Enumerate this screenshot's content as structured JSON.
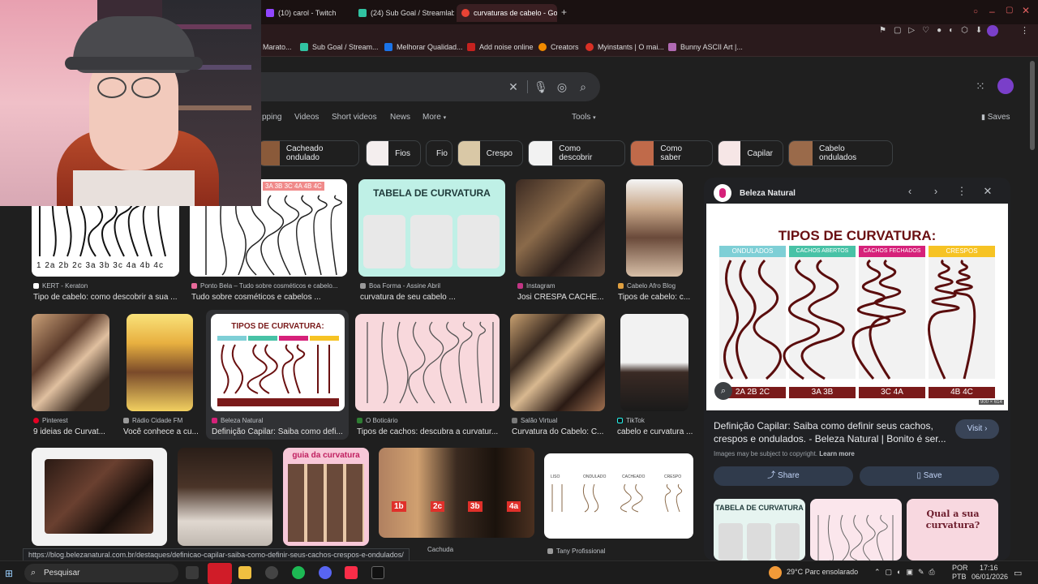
{
  "browser": {
    "tabs": [
      {
        "label": "(10) carol - Twitch",
        "color": "#9146ff"
      },
      {
        "label": "(24) Sub Goal / Streamlab",
        "color": "#31c3a2"
      },
      {
        "label": "curvaturas de cabelo - Go",
        "color": "#ea4335"
      }
    ],
    "bookmarks": [
      {
        "label": "Marato...",
        "color": "#d93025"
      },
      {
        "label": "Sub Goal / Stream...",
        "color": "#31c3a2"
      },
      {
        "label": "Melhorar Qualidad...",
        "color": "#1a73e8"
      },
      {
        "label": "Add noise online",
        "color": "#c5221f"
      },
      {
        "label": "Creators",
        "color": "#f28b00"
      },
      {
        "label": "Myinstants | O mai...",
        "color": "#d93025"
      },
      {
        "label": "Bunny ASCII Art |...",
        "color": "#b06ab3"
      }
    ]
  },
  "search": {
    "tabs": [
      "pping",
      "Videos",
      "Short videos",
      "News",
      "More",
      "Tools"
    ],
    "saves_label": "Saves"
  },
  "chips": [
    {
      "label": "Cacheado ondulado"
    },
    {
      "label": "Fios"
    },
    {
      "label": "Fio"
    },
    {
      "label": "Crespo"
    },
    {
      "label": "Como descobrir"
    },
    {
      "label": "Como saber"
    },
    {
      "label": "Capilar"
    },
    {
      "label": "Cabelo ondulados"
    }
  ],
  "results": [
    {
      "source": "KERT - Keraton",
      "title": "Tipo de cabelo: como descobrir a sua ...",
      "img_text": "1 2a 2b 2c 3a 3b 3c 4a 4b 4c"
    },
    {
      "source": "Ponto Bela – Tudo sobre cosméticos e cabelo...",
      "title": "Tudo sobre cosméticos e cabelos ...",
      "img_text": "3A 3B 3C 4A 4B 4C"
    },
    {
      "source": "Boa Forma - Assine Abril",
      "title": "curvatura de seu cabelo ...",
      "img_text": "TABELA DE CURVATURA"
    },
    {
      "source": "Instagram",
      "title": "Josi CRESPA CACHE...",
      "img_text": ""
    },
    {
      "source": "Cabelo Afro Blog",
      "title": "Tipos de cabelo: c...",
      "img_text": ""
    },
    {
      "source": "Pinterest",
      "title": "9 ideias de Curvat...",
      "img_text": ""
    },
    {
      "source": "Rádio Cidade FM",
      "title": "Você conhece a cu...",
      "img_text": ""
    },
    {
      "source": "Beleza Natural",
      "title": "Definição Capilar: Saiba como defi...",
      "img_text": "TIPOS DE CURVATURA:"
    },
    {
      "source": "O Boticário",
      "title": "Tipos de cachos: descubra a curvatur...",
      "img_text": ""
    },
    {
      "source": "Salão Virtual",
      "title": "Curvatura do Cabelo: C...",
      "img_text": ""
    },
    {
      "source": "TikTok",
      "title": "cabelo e curvatura ...",
      "img_text": ""
    },
    {
      "source": "Cachuda",
      "title": "",
      "img_text": ""
    },
    {
      "source": "Tany Profissional",
      "title": "",
      "img_text": ""
    }
  ],
  "row3_labels": {
    "guia": "guia da curvatura",
    "hair": [
      "1b",
      "2c",
      "3b",
      "4a"
    ],
    "chart": [
      "LISO",
      "ONDULADO",
      "CACHEADO",
      "CRESPO"
    ]
  },
  "panel": {
    "source": "Beleza Natural",
    "image": {
      "heading": "TIPOS DE CURVATURA:",
      "columns": [
        {
          "label": "ONDULADOS",
          "color": "#7ecfd6",
          "types": "2A 2B 2C"
        },
        {
          "label": "CACHOS ABERTOS",
          "color": "#48c2a6",
          "types": "3A 3B"
        },
        {
          "label": "CACHOS FECHADOS",
          "color": "#d6217a",
          "types": "3C 4A"
        },
        {
          "label": "CRESPOS",
          "color": "#f6c324",
          "types": "4B 4C"
        }
      ],
      "size": "900 × 614"
    },
    "title": "Definição Capilar: Saiba como definir seus cachos, crespos e ondulados. - Beleza Natural | Bonito é ser...",
    "visit_label": "Visit",
    "copyright": "Images may be subject to copyright.",
    "learn_more": "Learn more",
    "share_label": "Share",
    "save_label": "Save",
    "related": [
      "TABELA DE CURVATURA",
      "",
      "Qual a sua curvatura?"
    ]
  },
  "status_url": "https://blog.belezanatural.com.br/destaques/definicao-capilar-saiba-como-definir-seus-cachos-crespos-e-ondulados/",
  "taskbar": {
    "search_placeholder": "Pesquisar",
    "weather": "29°C  Parc ensolarado",
    "lang1": "POR",
    "lang2": "PTB",
    "time": "17:16",
    "date": "06/01/2026"
  }
}
